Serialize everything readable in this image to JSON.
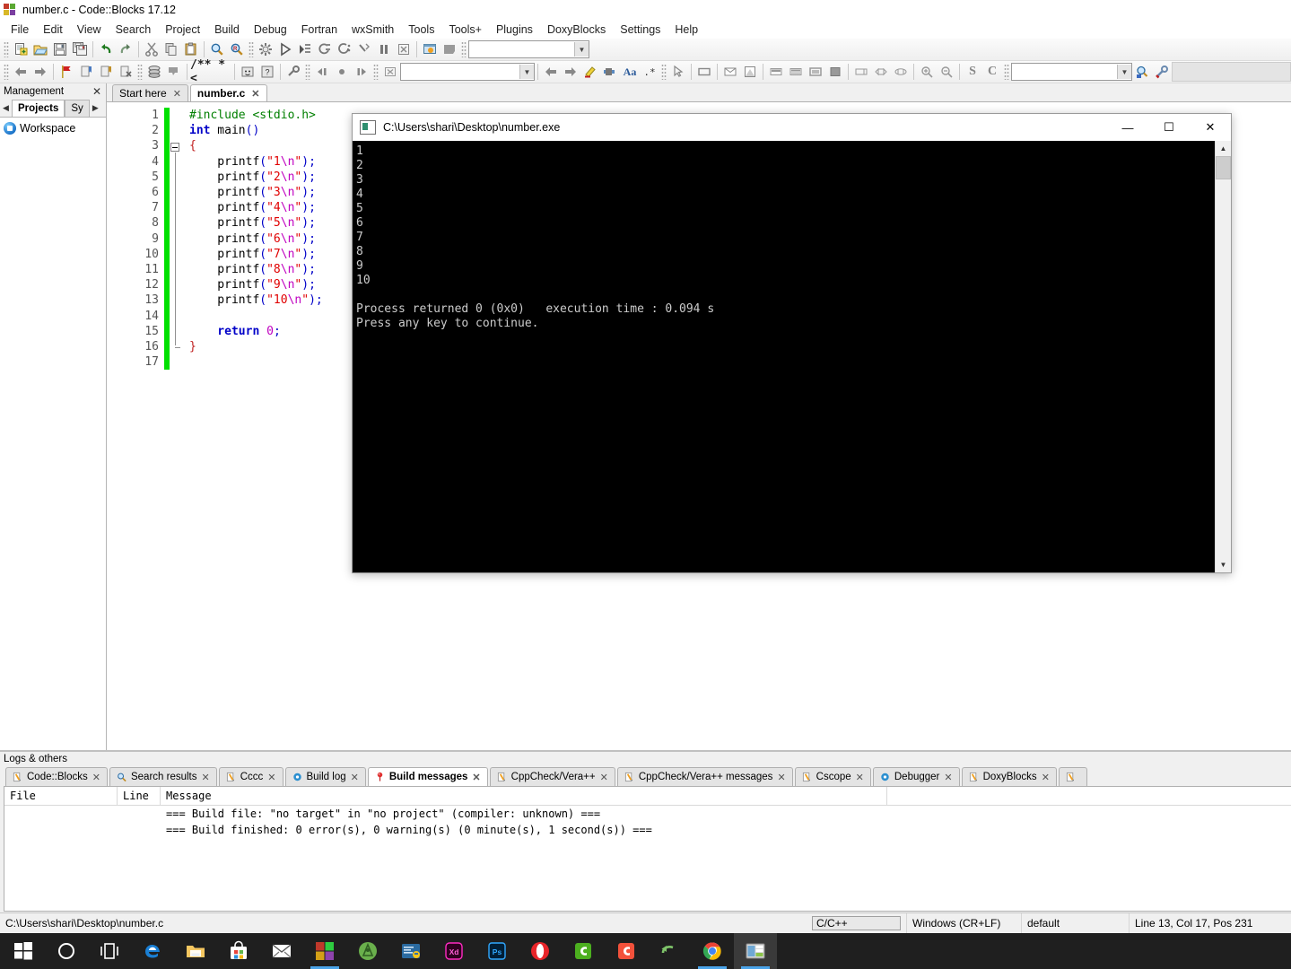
{
  "window": {
    "title": "number.c - Code::Blocks 17.12",
    "app_icon": "codeblocks-logo-icon"
  },
  "menu": {
    "items": [
      "File",
      "Edit",
      "View",
      "Search",
      "Project",
      "Build",
      "Debug",
      "Fortran",
      "wxSmith",
      "Tools",
      "Tools+",
      "Plugins",
      "DoxyBlocks",
      "Settings",
      "Help"
    ]
  },
  "toolbar": {
    "row1_icons": [
      "new-file-icon",
      "open-file-icon",
      "save-icon",
      "save-all-icon",
      "undo-icon",
      "redo-icon",
      "cut-icon",
      "copy-icon",
      "paste-icon",
      "find-icon",
      "replace-icon",
      "build-icon",
      "run-icon",
      "build-and-run-icon",
      "rebuild-icon",
      "abort-icon",
      "debug-run-icon",
      "debug-stop-icon"
    ],
    "row2_icons": [
      "back-icon",
      "forward-icon",
      "toggle-bookmark-icon",
      "prev-bookmark-icon",
      "next-bookmark-icon",
      "clear-bookmarks-icon",
      "class-browser-icon",
      "symbols-icon",
      "doxyblocks-comment-icon",
      "doxyblocks-run-icon",
      "doxyblocks-help-icon",
      "doxyblocks-config-icon",
      "step-back-icon",
      "breakpoint-icon",
      "step-forward-icon",
      "stop-debug-icon",
      "pointer-icon",
      "panel-icon",
      "dialog-icon",
      "frame-icon",
      "layout-1-icon",
      "layout-2-icon",
      "layout-3-icon",
      "layout-4-icon",
      "sizer-1-icon",
      "sizer-2-icon",
      "sizer-3-icon",
      "zoom-in-icon",
      "zoom-out-icon",
      "scope-s-icon",
      "scope-c-icon",
      "search-scope-icon",
      "settings-wrench-icon"
    ],
    "build_target_value": "",
    "search_value": "",
    "symbol_value": "",
    "cscope_value": ""
  },
  "management": {
    "title": "Management",
    "close_label": "✕",
    "tabs": [
      {
        "label": "Projects",
        "active": true
      },
      {
        "label": "Sy",
        "active": false
      }
    ],
    "tree": [
      {
        "label": "Workspace",
        "icon": "workspace-icon"
      }
    ]
  },
  "editor": {
    "tabs": [
      {
        "label": "Start here",
        "active": false,
        "close": "✕"
      },
      {
        "label": "number.c",
        "active": true,
        "close": "✕"
      }
    ],
    "line_numbers": [
      1,
      2,
      3,
      4,
      5,
      6,
      7,
      8,
      9,
      10,
      11,
      12,
      13,
      14,
      15,
      16,
      17
    ],
    "code_lines": [
      {
        "n": 1,
        "segs": [
          {
            "t": "#include <stdio.h>",
            "c": "pre"
          }
        ]
      },
      {
        "n": 2,
        "segs": [
          {
            "t": "int",
            "c": "kw"
          },
          {
            "t": " main",
            "c": "fn"
          },
          {
            "t": "()",
            "c": "op"
          }
        ]
      },
      {
        "n": 3,
        "segs": [
          {
            "t": "{",
            "c": "brc"
          }
        ]
      },
      {
        "n": 4,
        "segs": [
          {
            "t": "    printf",
            "c": "fn"
          },
          {
            "t": "(",
            "c": "op"
          },
          {
            "t": "\"1",
            "c": "str"
          },
          {
            "t": "\\n",
            "c": "esc"
          },
          {
            "t": "\"",
            "c": "str"
          },
          {
            "t": ");",
            "c": "op"
          }
        ]
      },
      {
        "n": 5,
        "segs": [
          {
            "t": "    printf",
            "c": "fn"
          },
          {
            "t": "(",
            "c": "op"
          },
          {
            "t": "\"2",
            "c": "str"
          },
          {
            "t": "\\n",
            "c": "esc"
          },
          {
            "t": "\"",
            "c": "str"
          },
          {
            "t": ");",
            "c": "op"
          }
        ]
      },
      {
        "n": 6,
        "segs": [
          {
            "t": "    printf",
            "c": "fn"
          },
          {
            "t": "(",
            "c": "op"
          },
          {
            "t": "\"3",
            "c": "str"
          },
          {
            "t": "\\n",
            "c": "esc"
          },
          {
            "t": "\"",
            "c": "str"
          },
          {
            "t": ");",
            "c": "op"
          }
        ]
      },
      {
        "n": 7,
        "segs": [
          {
            "t": "    printf",
            "c": "fn"
          },
          {
            "t": "(",
            "c": "op"
          },
          {
            "t": "\"4",
            "c": "str"
          },
          {
            "t": "\\n",
            "c": "esc"
          },
          {
            "t": "\"",
            "c": "str"
          },
          {
            "t": ");",
            "c": "op"
          }
        ]
      },
      {
        "n": 8,
        "segs": [
          {
            "t": "    printf",
            "c": "fn"
          },
          {
            "t": "(",
            "c": "op"
          },
          {
            "t": "\"5",
            "c": "str"
          },
          {
            "t": "\\n",
            "c": "esc"
          },
          {
            "t": "\"",
            "c": "str"
          },
          {
            "t": ");",
            "c": "op"
          }
        ]
      },
      {
        "n": 9,
        "segs": [
          {
            "t": "    printf",
            "c": "fn"
          },
          {
            "t": "(",
            "c": "op"
          },
          {
            "t": "\"6",
            "c": "str"
          },
          {
            "t": "\\n",
            "c": "esc"
          },
          {
            "t": "\"",
            "c": "str"
          },
          {
            "t": ");",
            "c": "op"
          }
        ]
      },
      {
        "n": 10,
        "segs": [
          {
            "t": "    printf",
            "c": "fn"
          },
          {
            "t": "(",
            "c": "op"
          },
          {
            "t": "\"7",
            "c": "str"
          },
          {
            "t": "\\n",
            "c": "esc"
          },
          {
            "t": "\"",
            "c": "str"
          },
          {
            "t": ");",
            "c": "op"
          }
        ]
      },
      {
        "n": 11,
        "segs": [
          {
            "t": "    printf",
            "c": "fn"
          },
          {
            "t": "(",
            "c": "op"
          },
          {
            "t": "\"8",
            "c": "str"
          },
          {
            "t": "\\n",
            "c": "esc"
          },
          {
            "t": "\"",
            "c": "str"
          },
          {
            "t": ");",
            "c": "op"
          }
        ]
      },
      {
        "n": 12,
        "segs": [
          {
            "t": "    printf",
            "c": "fn"
          },
          {
            "t": "(",
            "c": "op"
          },
          {
            "t": "\"9",
            "c": "str"
          },
          {
            "t": "\\n",
            "c": "esc"
          },
          {
            "t": "\"",
            "c": "str"
          },
          {
            "t": ");",
            "c": "op"
          }
        ]
      },
      {
        "n": 13,
        "segs": [
          {
            "t": "    printf",
            "c": "fn"
          },
          {
            "t": "(",
            "c": "op"
          },
          {
            "t": "\"10",
            "c": "str"
          },
          {
            "t": "\\n",
            "c": "esc"
          },
          {
            "t": "\"",
            "c": "str"
          },
          {
            "t": ");",
            "c": "op"
          }
        ]
      },
      {
        "n": 14,
        "segs": [
          {
            "t": "",
            "c": "fn"
          }
        ]
      },
      {
        "n": 15,
        "segs": [
          {
            "t": "    return",
            "c": "kw"
          },
          {
            "t": " ",
            "c": "fn"
          },
          {
            "t": "0",
            "c": "num"
          },
          {
            "t": ";",
            "c": "op"
          }
        ]
      },
      {
        "n": 16,
        "segs": [
          {
            "t": "}",
            "c": "brc"
          }
        ]
      },
      {
        "n": 17,
        "segs": [
          {
            "t": "",
            "c": "fn"
          }
        ]
      }
    ]
  },
  "console": {
    "title": "C:\\Users\\shari\\Desktop\\number.exe",
    "icon": "console-window-icon",
    "minimize_label": "—",
    "maximize_label": "☐",
    "close_label": "✕",
    "output": "1\n2\n3\n4\n5\n6\n7\n8\n9\n10\n\nProcess returned 0 (0x0)   execution time : 0.094 s\nPress any key to continue.\n",
    "scroll_up_label": "▲",
    "scroll_down_label": "▼"
  },
  "logs": {
    "title": "Logs & others",
    "tabs": [
      {
        "label": "Code::Blocks",
        "icon": "pencil-icon",
        "active": false,
        "close": "✕"
      },
      {
        "label": "Search results",
        "icon": "search-icon",
        "active": false,
        "close": "✕"
      },
      {
        "label": "Cccc",
        "icon": "pencil-icon",
        "active": false,
        "close": "✕"
      },
      {
        "label": "Build log",
        "icon": "gear-blue-icon",
        "active": false,
        "close": "✕"
      },
      {
        "label": "Build messages",
        "icon": "pin-icon",
        "active": true,
        "close": "✕"
      },
      {
        "label": "CppCheck/Vera++",
        "icon": "pencil-icon",
        "active": false,
        "close": "✕"
      },
      {
        "label": "CppCheck/Vera++ messages",
        "icon": "pencil-icon",
        "active": false,
        "close": "✕"
      },
      {
        "label": "Cscope",
        "icon": "pencil-icon",
        "active": false,
        "close": "✕"
      },
      {
        "label": "Debugger",
        "icon": "gear-blue-icon",
        "active": false,
        "close": "✕"
      },
      {
        "label": "DoxyBlocks",
        "icon": "pencil-icon",
        "active": false,
        "close": "✕"
      },
      {
        "label": "",
        "icon": "pencil-icon",
        "active": false,
        "close": ""
      }
    ],
    "columns": [
      "File",
      "Line",
      "Message"
    ],
    "rows": [
      {
        "file": "",
        "line": "",
        "message": "=== Build file: \"no target\" in \"no project\" (compiler: unknown) ==="
      },
      {
        "file": "",
        "line": "",
        "message": "=== Build finished: 0 error(s), 0 warning(s) (0 minute(s), 1 second(s)) ==="
      }
    ]
  },
  "statusbar": {
    "path": "C:\\Users\\shari\\Desktop\\number.c",
    "language": "C/C++",
    "eol": "Windows (CR+LF)",
    "profile": "default",
    "position": "Line 13, Col 17, Pos 231"
  },
  "taskbar": {
    "items": [
      {
        "name": "start-button",
        "icon": "windows-logo-icon",
        "active": false,
        "running": false
      },
      {
        "name": "cortana-search",
        "icon": "circle-icon",
        "active": false,
        "running": false
      },
      {
        "name": "task-view",
        "icon": "task-view-icon",
        "active": false,
        "running": false
      },
      {
        "name": "edge-browser",
        "icon": "edge-icon",
        "active": false,
        "running": false
      },
      {
        "name": "file-explorer",
        "icon": "folder-icon",
        "active": false,
        "running": false
      },
      {
        "name": "microsoft-store",
        "icon": "store-icon",
        "active": false,
        "running": false
      },
      {
        "name": "mail-app",
        "icon": "mail-icon",
        "active": false,
        "running": false
      },
      {
        "name": "visual-studio",
        "icon": "vs-squares-icon",
        "active": false,
        "running": true
      },
      {
        "name": "android-studio",
        "icon": "android-studio-icon",
        "active": false,
        "running": false
      },
      {
        "name": "python-idle",
        "icon": "python-editor-icon",
        "active": false,
        "running": false
      },
      {
        "name": "adobe-xd",
        "icon": "xd-icon",
        "active": false,
        "running": false
      },
      {
        "name": "photoshop",
        "icon": "ps-icon",
        "active": false,
        "running": false
      },
      {
        "name": "opera-browser",
        "icon": "opera-icon",
        "active": false,
        "running": false
      },
      {
        "name": "camtasia",
        "icon": "camtasia-green-icon",
        "active": false,
        "running": false
      },
      {
        "name": "camtasia-recorder",
        "icon": "camtasia-red-icon",
        "active": false,
        "running": false
      },
      {
        "name": "undo-app",
        "icon": "undo-arrow-icon",
        "active": false,
        "running": false
      },
      {
        "name": "chrome-browser",
        "icon": "chrome-icon",
        "active": false,
        "running": true
      },
      {
        "name": "codeblocks-app",
        "icon": "codeblocks-win-icon",
        "active": true,
        "running": true
      }
    ]
  },
  "colors": {
    "changebar_green": "#00e000",
    "console_bg": "#000000",
    "console_text": "#cccccc",
    "accent_blue": "#4aa3e8",
    "preprocessor": "#007f00",
    "keyword": "#0000c8",
    "string": "#e00000",
    "escape": "#c000c0"
  }
}
